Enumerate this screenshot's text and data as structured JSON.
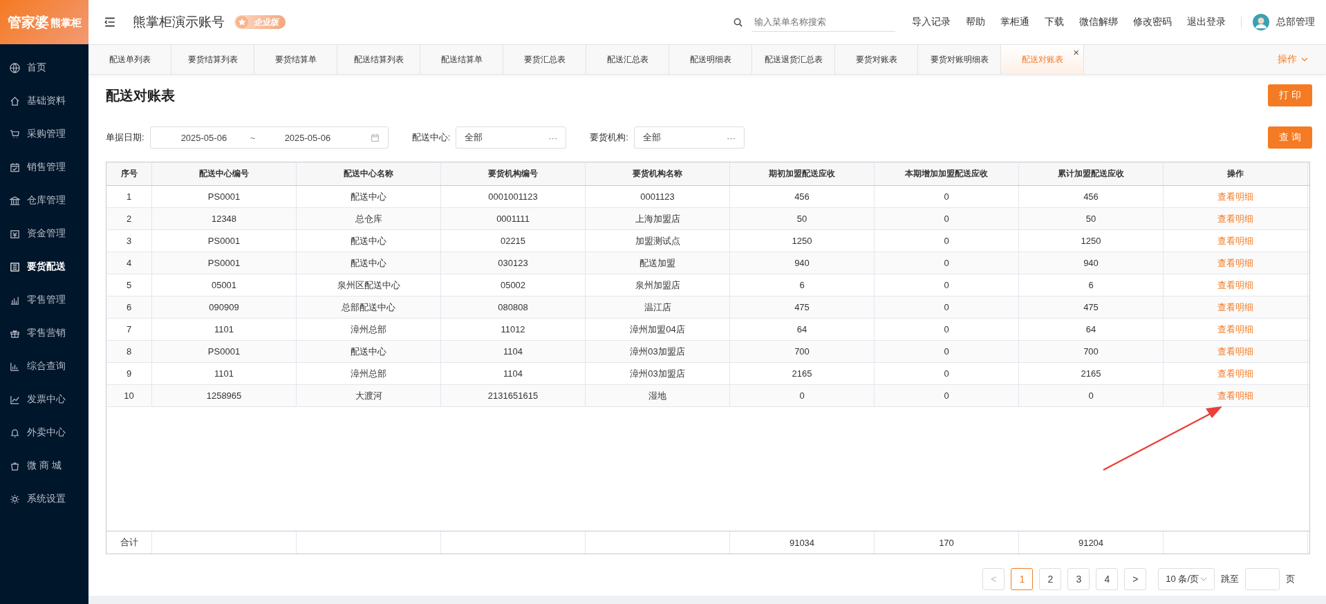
{
  "sidebar": {
    "logo": {
      "brand": "管家婆",
      "sub": "熊掌柜"
    },
    "items": [
      {
        "label": "首页",
        "selected": false
      },
      {
        "label": "基础资料",
        "selected": false
      },
      {
        "label": "采购管理",
        "selected": false
      },
      {
        "label": "销售管理",
        "selected": false
      },
      {
        "label": "仓库管理",
        "selected": false
      },
      {
        "label": "资金管理",
        "selected": false
      },
      {
        "label": "要货配送",
        "selected": true
      },
      {
        "label": "零售管理",
        "selected": false
      },
      {
        "label": "零售营销",
        "selected": false
      },
      {
        "label": "综合查询",
        "selected": false
      },
      {
        "label": "发票中心",
        "selected": false
      },
      {
        "label": "外卖中心",
        "selected": false
      },
      {
        "label": "微 商 城",
        "selected": false
      },
      {
        "label": "系统设置",
        "selected": false
      }
    ]
  },
  "header": {
    "account": "熊掌柜演示账号",
    "edition": "企业版",
    "search": {
      "placeholder": "输入菜单名称搜索"
    },
    "links": [
      "导入记录",
      "帮助",
      "掌柜通",
      "下载",
      "微信解绑",
      "修改密码",
      "退出登录"
    ],
    "user": "总部管理"
  },
  "tabs": [
    {
      "label": "配送单列表",
      "selected": false
    },
    {
      "label": "要货结算列表",
      "selected": false
    },
    {
      "label": "要货结算单",
      "selected": false
    },
    {
      "label": "配送结算列表",
      "selected": false
    },
    {
      "label": "配送结算单",
      "selected": false
    },
    {
      "label": "要货汇总表",
      "selected": false
    },
    {
      "label": "配送汇总表",
      "selected": false
    },
    {
      "label": "配送明细表",
      "selected": false
    },
    {
      "label": "配送退货汇总表",
      "selected": false
    },
    {
      "label": "要货对账表",
      "selected": false
    },
    {
      "label": "要货对账明细表",
      "selected": false
    },
    {
      "label": "配送对账表",
      "selected": true
    }
  ],
  "tab_close": "×",
  "tab_menu": "操作",
  "page": {
    "title": "配送对账表",
    "print_button": "打 印",
    "query_button": "查 询",
    "filters": {
      "date_label": "单据日期:",
      "date_start": "2025-05-06",
      "date_sep": "~",
      "date_end": "2025-05-06",
      "center_label": "配送中心:",
      "center_value": "全部",
      "org_label": "要货机构:",
      "org_value": "全部",
      "more": "···"
    }
  },
  "table": {
    "columns": [
      "序号",
      "配送中心编号",
      "配送中心名称",
      "要货机构编号",
      "要货机构名称",
      "期初加盟配送应收",
      "本期增加加盟配送应收",
      "累计加盟配送应收",
      "操作"
    ],
    "rows": [
      [
        "1",
        "PS0001",
        "配送中心",
        "0001001123",
        "0001123",
        "456",
        "0",
        "456",
        "查看明细"
      ],
      [
        "2",
        "12348",
        "总仓库",
        "0001111",
        "上海加盟店",
        "50",
        "0",
        "50",
        "查看明细"
      ],
      [
        "3",
        "PS0001",
        "配送中心",
        "02215",
        "加盟测试点",
        "1250",
        "0",
        "1250",
        "查看明细"
      ],
      [
        "4",
        "PS0001",
        "配送中心",
        "030123",
        "配送加盟",
        "940",
        "0",
        "940",
        "查看明细"
      ],
      [
        "5",
        "05001",
        "泉州区配送中心",
        "05002",
        "泉州加盟店",
        "6",
        "0",
        "6",
        "查看明细"
      ],
      [
        "6",
        "090909",
        "总部配送中心",
        "080808",
        "温江店",
        "475",
        "0",
        "475",
        "查看明细"
      ],
      [
        "7",
        "1101",
        "漳州总部",
        "11012",
        "漳州加盟04店",
        "64",
        "0",
        "64",
        "查看明细"
      ],
      [
        "8",
        "PS0001",
        "配送中心",
        "1104",
        "漳州03加盟店",
        "700",
        "0",
        "700",
        "查看明细"
      ],
      [
        "9",
        "1101",
        "漳州总部",
        "1104",
        "漳州03加盟店",
        "2165",
        "0",
        "2165",
        "查看明细"
      ],
      [
        "10",
        "1258965",
        "大渡河",
        "2131651615",
        "湿地",
        "0",
        "0",
        "0",
        "查看明细"
      ]
    ],
    "totals": {
      "label": "合计",
      "opening": "91034",
      "increase": "170",
      "cumulative": "91204"
    }
  },
  "pagination": {
    "prev": "<",
    "pages": [
      {
        "label": "1",
        "selected": true
      },
      {
        "label": "2",
        "selected": false
      },
      {
        "label": "3",
        "selected": false
      },
      {
        "label": "4",
        "selected": false
      }
    ],
    "next": ">",
    "page_size": "10 条/页",
    "jump_label": "跳至",
    "page_unit": "页"
  }
}
